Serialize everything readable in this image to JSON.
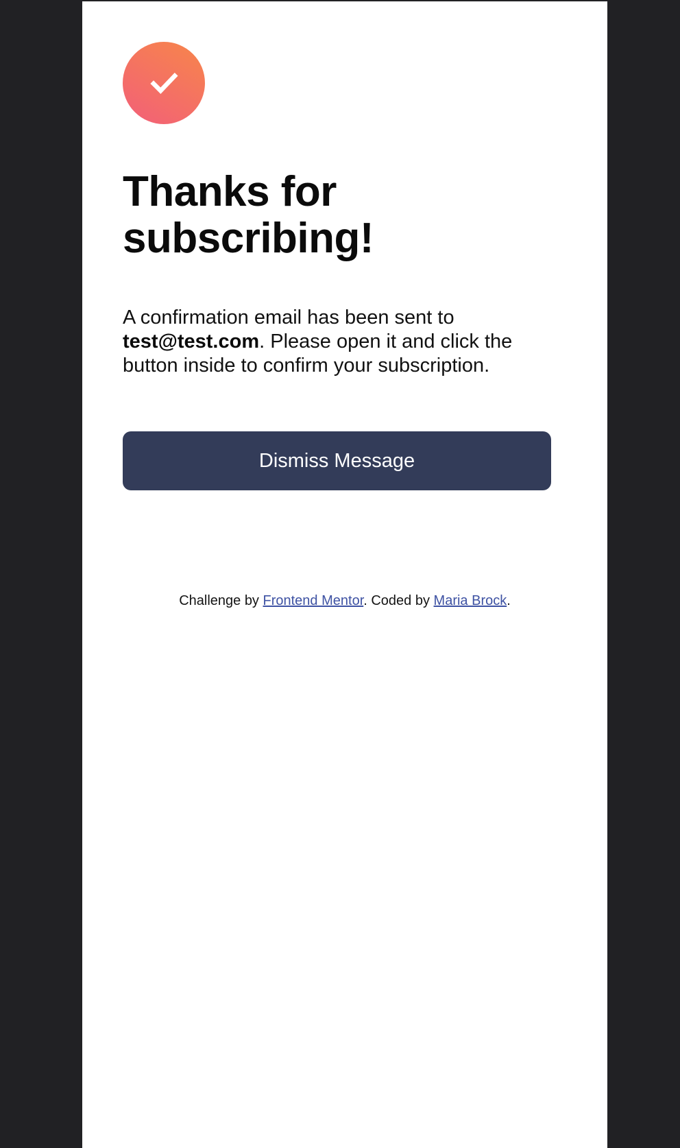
{
  "colors": {
    "page_background": "#212124",
    "card_background": "#ffffff",
    "icon_gradient_start": "#f7864a",
    "icon_gradient_end": "#f25f79",
    "button_background": "#333c59",
    "link": "#3e52a3"
  },
  "success": {
    "icon": "checkmark-icon",
    "title_line1": "Thanks for",
    "title_line2": "subscribing!",
    "message_prefix": "A confirmation email has been sent to",
    "email": "test@test.com",
    "message_suffix": ". Please open it and click the button inside to confirm your subscription.",
    "dismiss_label": "Dismiss Message"
  },
  "footer": {
    "challenge_prefix": "Challenge by ",
    "challenge_link": "Frontend Mentor",
    "coded_prefix": ". Coded by ",
    "coded_link": "Maria Brock",
    "suffix": "."
  }
}
